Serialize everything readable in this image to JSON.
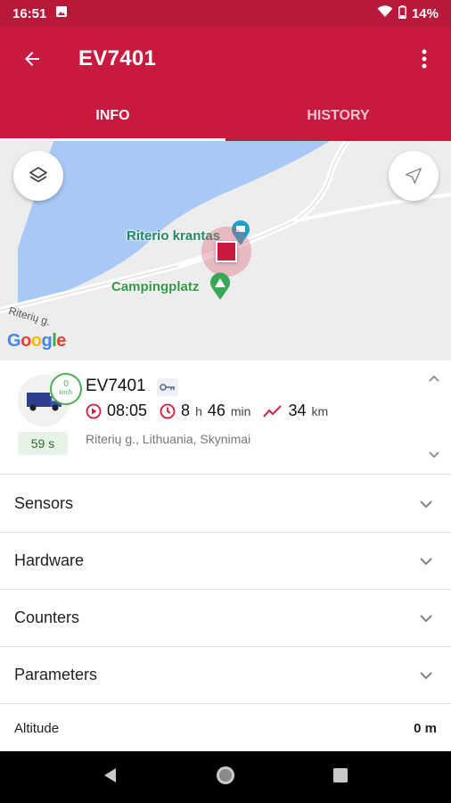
{
  "status_bar": {
    "time": "16:51",
    "battery": "14%"
  },
  "app_bar": {
    "title": "EV7401"
  },
  "tabs": [
    {
      "label": "INFO",
      "active": true
    },
    {
      "label": "HISTORY",
      "active": false
    }
  ],
  "map": {
    "poi_1": "Riterio krantas",
    "poi_2": "Campingplatz",
    "road": "Riterių g.",
    "attribution": [
      "G",
      "o",
      "o",
      "g",
      "l",
      "e"
    ]
  },
  "vehicle": {
    "name": "EV7401",
    "speed_value": "0",
    "speed_unit": "km/h",
    "last_update": "59 s",
    "start_time": "08:05",
    "duration_h": "8",
    "duration_h_unit": "h",
    "duration_min": "46",
    "duration_min_unit": "min",
    "distance": "34",
    "distance_unit": "km",
    "address": "Riterių g., Lithuania, Skynimai"
  },
  "sections": [
    "Sensors",
    "Hardware",
    "Counters",
    "Parameters"
  ],
  "altitude": {
    "label": "Altitude",
    "value": "0 m"
  },
  "colors": {
    "brand": "#c8193f",
    "status": "#b8183a",
    "speed_ok": "#4caf50"
  }
}
